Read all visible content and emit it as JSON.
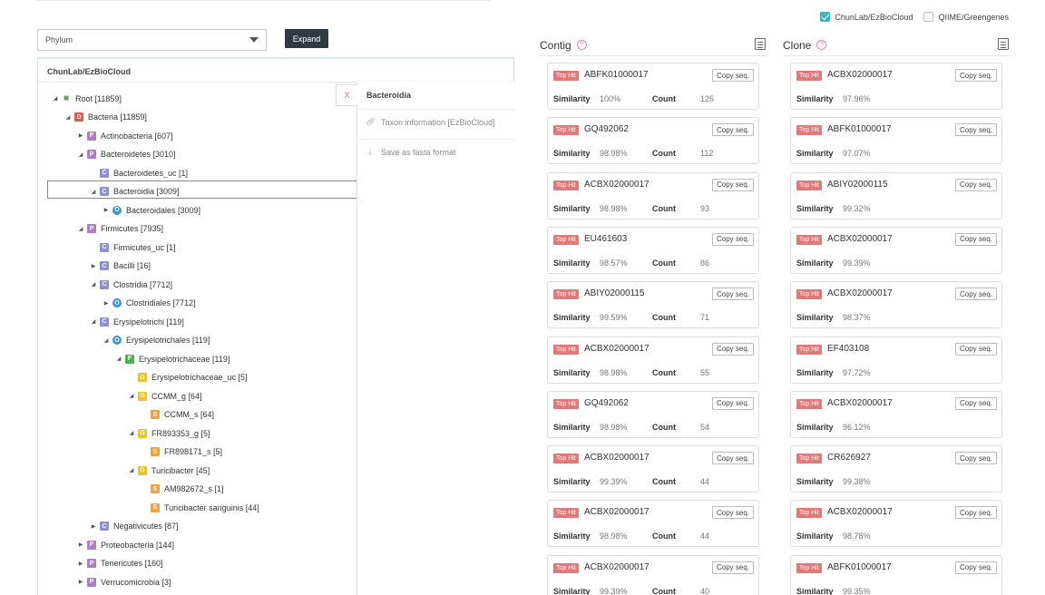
{
  "db_options": [
    {
      "label": "ChunLab/EzBioCloud",
      "checked": true
    },
    {
      "label": "QIIME/Greengenes",
      "checked": false
    }
  ],
  "rank_select": {
    "value": "Phylum"
  },
  "expand_label": "Expand",
  "tree": {
    "title": "ChunLab/EzBioCloud",
    "nodes": [
      {
        "depth": 0,
        "toggle": "open",
        "rank": "R",
        "label": "Root [11859]"
      },
      {
        "depth": 1,
        "toggle": "open",
        "rank": "D",
        "label": "Bacteria [11859]"
      },
      {
        "depth": 2,
        "toggle": "closed",
        "rank": "P",
        "label": "Actinobacteria [607]"
      },
      {
        "depth": 2,
        "toggle": "open",
        "rank": "P",
        "label": "Bacteroidetes [3010]"
      },
      {
        "depth": 3,
        "toggle": "none",
        "rank": "C",
        "label": "Bacteroidetes_uc [1]"
      },
      {
        "depth": 3,
        "toggle": "open",
        "rank": "C",
        "label": "Bacteroidia [3009]"
      },
      {
        "depth": 4,
        "toggle": "closed",
        "rank": "O",
        "label": "Bacteroidales [3009]"
      },
      {
        "depth": 2,
        "toggle": "open",
        "rank": "P",
        "label": "Firmicutes [7935]"
      },
      {
        "depth": 3,
        "toggle": "none",
        "rank": "C",
        "label": "Firmicutes_uc [1]"
      },
      {
        "depth": 3,
        "toggle": "closed",
        "rank": "C",
        "label": "Bacilli [16]"
      },
      {
        "depth": 3,
        "toggle": "open",
        "rank": "C",
        "label": "Clostridia [7712]"
      },
      {
        "depth": 4,
        "toggle": "closed",
        "rank": "O",
        "label": "Clostridiales [7712]"
      },
      {
        "depth": 3,
        "toggle": "open",
        "rank": "C",
        "label": "Erysipelotrichi [119]"
      },
      {
        "depth": 4,
        "toggle": "open",
        "rank": "O",
        "label": "Erysipelotrichales [119]"
      },
      {
        "depth": 5,
        "toggle": "open",
        "rank": "F",
        "label": "Erysipelotrichaceae [119]"
      },
      {
        "depth": 6,
        "toggle": "none",
        "rank": "G",
        "label": "Erysipelotrichaceae_uc [5]"
      },
      {
        "depth": 6,
        "toggle": "open",
        "rank": "G",
        "label": "CCMM_g [64]"
      },
      {
        "depth": 7,
        "toggle": "none",
        "rank": "S",
        "label": "CCMM_s [64]"
      },
      {
        "depth": 6,
        "toggle": "open",
        "rank": "G",
        "label": "FR893353_g [5]"
      },
      {
        "depth": 7,
        "toggle": "none",
        "rank": "S",
        "label": "FR898171_s [5]"
      },
      {
        "depth": 6,
        "toggle": "open",
        "rank": "G",
        "label": "Turicibacter [45]"
      },
      {
        "depth": 7,
        "toggle": "none",
        "rank": "S",
        "label": "AM982672_s [1]"
      },
      {
        "depth": 7,
        "toggle": "none",
        "rank": "S",
        "label": "Turicibacter sanguinis [44]"
      },
      {
        "depth": 3,
        "toggle": "closed",
        "rank": "C",
        "label": "Negativicutes [87]"
      },
      {
        "depth": 2,
        "toggle": "closed",
        "rank": "P",
        "label": "Proteobacteria [144]"
      },
      {
        "depth": 2,
        "toggle": "closed",
        "rank": "P",
        "label": "Tenericutes [160]"
      },
      {
        "depth": 2,
        "toggle": "closed",
        "rank": "P",
        "label": "Verrucomicrobia [3]"
      }
    ],
    "selected_index": 5
  },
  "context_menu": {
    "close_label": "X",
    "title": "Bacteroidia",
    "items": [
      {
        "icon": "link-icon",
        "label": "Taxon information [EzBioCloud]"
      },
      {
        "icon": "download-icon",
        "label": "Save as fasta format"
      }
    ]
  },
  "labels": {
    "top_hit": "Top Hit",
    "copy_seq": "Copy seq.",
    "similarity": "Similarity",
    "count": "Count"
  },
  "contig": {
    "title": "Contig",
    "help": "?",
    "hits": [
      {
        "accession": "ABFK01000017",
        "similarity": "100%",
        "count": "125"
      },
      {
        "accession": "GQ492062",
        "similarity": "98.98%",
        "count": "112"
      },
      {
        "accession": "ACBX02000017",
        "similarity": "98.98%",
        "count": "93"
      },
      {
        "accession": "EU461603",
        "similarity": "98.57%",
        "count": "86"
      },
      {
        "accession": "ABIY02000115",
        "similarity": "99.59%",
        "count": "71"
      },
      {
        "accession": "ACBX02000017",
        "similarity": "98.98%",
        "count": "55"
      },
      {
        "accession": "GQ492062",
        "similarity": "98.98%",
        "count": "54"
      },
      {
        "accession": "ACBX02000017",
        "similarity": "99.39%",
        "count": "44"
      },
      {
        "accession": "ACBX02000017",
        "similarity": "98.98%",
        "count": "44"
      },
      {
        "accession": "ACBX02000017",
        "similarity": "99.39%",
        "count": "40"
      }
    ]
  },
  "clone": {
    "title": "Clone",
    "help": "?",
    "hits": [
      {
        "accession": "ACBX02000017",
        "similarity": "97.96%"
      },
      {
        "accession": "ABFK01000017",
        "similarity": "97.07%"
      },
      {
        "accession": "ABIY02000115",
        "similarity": "99.32%"
      },
      {
        "accession": "ACBX02000017",
        "similarity": "99.39%"
      },
      {
        "accession": "ACBX02000017",
        "similarity": "98.37%"
      },
      {
        "accession": "EF403108",
        "similarity": "97.72%"
      },
      {
        "accession": "ACBX02000017",
        "similarity": "96.12%"
      },
      {
        "accession": "CR626927",
        "similarity": "99.38%"
      },
      {
        "accession": "ACBX02000017",
        "similarity": "98.78%"
      },
      {
        "accession": "ABFK01000017",
        "similarity": "99.35%"
      }
    ]
  }
}
